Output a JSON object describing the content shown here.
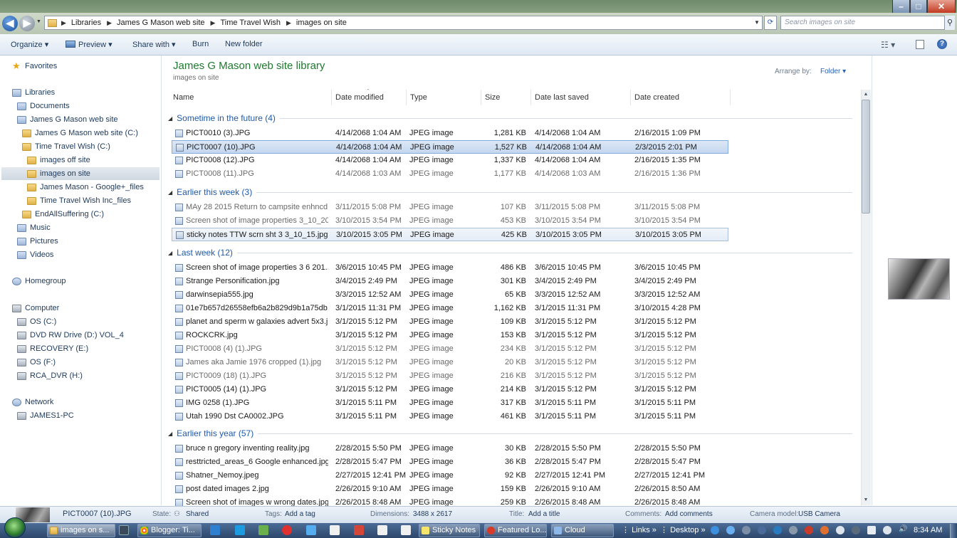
{
  "window": {
    "minimize": "–",
    "maximize": "□",
    "close": "✕"
  },
  "address": {
    "crumbs": [
      "Libraries",
      "James G Mason web site",
      "Time Travel Wish",
      "images on site"
    ],
    "search_placeholder": "Search images on site"
  },
  "toolbar": {
    "organize": "Organize ▾",
    "preview": "Preview ▾",
    "share_with": "Share with ▾",
    "burn": "Burn",
    "new_folder": "New folder"
  },
  "sidebar": {
    "favorites": "Favorites",
    "libraries": "Libraries",
    "documents": "Documents",
    "jgm_site": "James G Mason web site",
    "jgm_site_c": "James G Mason web site (C:)",
    "ttw_c": "Time Travel Wish (C:)",
    "images_off": "images off site",
    "images_on": "images on site",
    "jm_google": "James Mason - Google+_files",
    "ttw_inc": "Time Travel Wish Inc_files",
    "endall": "EndAllSuffering (C:)",
    "music": "Music",
    "pictures": "Pictures",
    "videos": "Videos",
    "homegroup": "Homegroup",
    "computer": "Computer",
    "os_c": "OS (C:)",
    "dvd": "DVD RW Drive (D:) VOL_4",
    "recovery": "RECOVERY (E:)",
    "os_f": "OS (F:)",
    "rca": "RCA_DVR (H:)",
    "network": "Network",
    "james1": "JAMES1-PC"
  },
  "library": {
    "title": "James G Mason web site library",
    "subtitle": "images on site",
    "arrange_label": "Arrange by:",
    "arrange_value": "Folder ▾"
  },
  "columns": {
    "name": "Name",
    "date_modified": "Date modified",
    "type": "Type",
    "size": "Size",
    "date_last_saved": "Date last saved",
    "date_created": "Date created"
  },
  "groups": [
    {
      "title": "Sometime in the future (4)",
      "rows": [
        {
          "name": "PICT0010 (3).JPG",
          "modified": "4/14/2068 1:04 AM",
          "type": "JPEG image",
          "size": "1,281 KB",
          "saved": "4/14/2068 1:04 AM",
          "created": "2/16/2015 1:09 PM"
        },
        {
          "name": "PICT0007 (10).JPG",
          "modified": "4/14/2068 1:04 AM",
          "type": "JPEG image",
          "size": "1,527 KB",
          "saved": "4/14/2068 1:04 AM",
          "created": "2/3/2015 2:01 PM"
        },
        {
          "name": "PICT0008 (12).JPG",
          "modified": "4/14/2068 1:04 AM",
          "type": "JPEG image",
          "size": "1,337 KB",
          "saved": "4/14/2068 1:04 AM",
          "created": "2/16/2015 1:35 PM"
        },
        {
          "name": "PICT0008 (11).JPG",
          "modified": "4/14/2068 1:03 AM",
          "type": "JPEG image",
          "size": "1,177 KB",
          "saved": "4/14/2068 1:03 AM",
          "created": "2/16/2015 1:36 PM"
        }
      ]
    },
    {
      "title": "Earlier this week (3)",
      "rows": [
        {
          "name": "MAy 28 2015 Return to campsite enhncd...",
          "modified": "3/11/2015 5:08 PM",
          "type": "JPEG image",
          "size": "107 KB",
          "saved": "3/11/2015 5:08 PM",
          "created": "3/11/2015 5:08 PM"
        },
        {
          "name": "Screen shot of image properties 3_10_20...",
          "modified": "3/10/2015 3:54 PM",
          "type": "JPEG image",
          "size": "453 KB",
          "saved": "3/10/2015 3:54 PM",
          "created": "3/10/2015 3:54 PM"
        },
        {
          "name": "sticky notes TTW scrn sht 3 3_10_15.jpg",
          "modified": "3/10/2015 3:05 PM",
          "type": "JPEG image",
          "size": "425 KB",
          "saved": "3/10/2015 3:05 PM",
          "created": "3/10/2015 3:05 PM"
        }
      ]
    },
    {
      "title": "Last week (12)",
      "rows": [
        {
          "name": "Screen shot of image properties 3 6 201...",
          "modified": "3/6/2015 10:45 PM",
          "type": "JPEG image",
          "size": "486 KB",
          "saved": "3/6/2015 10:45 PM",
          "created": "3/6/2015 10:45 PM"
        },
        {
          "name": "Strange Personification.jpg",
          "modified": "3/4/2015 2:49 PM",
          "type": "JPEG image",
          "size": "301 KB",
          "saved": "3/4/2015 2:49 PM",
          "created": "3/4/2015 2:49 PM"
        },
        {
          "name": "darwinsepia555.jpg",
          "modified": "3/3/2015 12:52 AM",
          "type": "JPEG image",
          "size": "65 KB",
          "saved": "3/3/2015 12:52 AM",
          "created": "3/3/2015 12:52 AM"
        },
        {
          "name": "01e7b657d26558efb6a2b829d9b1a75db...",
          "modified": "3/1/2015 11:31 PM",
          "type": "JPEG image",
          "size": "1,162 KB",
          "saved": "3/1/2015 11:31 PM",
          "created": "3/10/2015 4:28 PM"
        },
        {
          "name": "planet and sperm w galaxies advert 5x3.j...",
          "modified": "3/1/2015 5:12 PM",
          "type": "JPEG image",
          "size": "109 KB",
          "saved": "3/1/2015 5:12 PM",
          "created": "3/1/2015 5:12 PM"
        },
        {
          "name": "ROCKCRK.jpg",
          "modified": "3/1/2015 5:12 PM",
          "type": "JPEG image",
          "size": "153 KB",
          "saved": "3/1/2015 5:12 PM",
          "created": "3/1/2015 5:12 PM"
        },
        {
          "name": "PICT0008 (4) (1).JPG",
          "modified": "3/1/2015 5:12 PM",
          "type": "JPEG image",
          "size": "234 KB",
          "saved": "3/1/2015 5:12 PM",
          "created": "3/1/2015 5:12 PM"
        },
        {
          "name": "James aka Jamie 1976 cropped (1).jpg",
          "modified": "3/1/2015 5:12 PM",
          "type": "JPEG image",
          "size": "20 KB",
          "saved": "3/1/2015 5:12 PM",
          "created": "3/1/2015 5:12 PM"
        },
        {
          "name": "PICT0009 (18) (1).JPG",
          "modified": "3/1/2015 5:12 PM",
          "type": "JPEG image",
          "size": "216 KB",
          "saved": "3/1/2015 5:12 PM",
          "created": "3/1/2015 5:12 PM"
        },
        {
          "name": "PICT0005 (14) (1).JPG",
          "modified": "3/1/2015 5:12 PM",
          "type": "JPEG image",
          "size": "214 KB",
          "saved": "3/1/2015 5:12 PM",
          "created": "3/1/2015 5:12 PM"
        },
        {
          "name": "IMG 0258 (1).JPG",
          "modified": "3/1/2015 5:11 PM",
          "type": "JPEG image",
          "size": "317 KB",
          "saved": "3/1/2015 5:11 PM",
          "created": "3/1/2015 5:11 PM"
        },
        {
          "name": "Utah 1990 Dst CA0002.JPG",
          "modified": "3/1/2015 5:11 PM",
          "type": "JPEG image",
          "size": "461 KB",
          "saved": "3/1/2015 5:11 PM",
          "created": "3/1/2015 5:11 PM"
        }
      ]
    },
    {
      "title": "Earlier this year (57)",
      "rows": [
        {
          "name": "bruce n gregory inventing reality.jpg",
          "modified": "2/28/2015 5:50 PM",
          "type": "JPEG image",
          "size": "30 KB",
          "saved": "2/28/2015 5:50 PM",
          "created": "2/28/2015 5:50 PM"
        },
        {
          "name": "resttricted_areas_6 Google enhanced.jpg",
          "modified": "2/28/2015 5:47 PM",
          "type": "JPEG image",
          "size": "36 KB",
          "saved": "2/28/2015 5:47 PM",
          "created": "2/28/2015 5:47 PM"
        },
        {
          "name": "Shatner_Nemoy.jpeg",
          "modified": "2/27/2015 12:41 PM",
          "type": "JPEG image",
          "size": "92 KB",
          "saved": "2/27/2015 12:41 PM",
          "created": "2/27/2015 12:41 PM"
        },
        {
          "name": "post dated images 2.jpg",
          "modified": "2/26/2015 9:10 AM",
          "type": "JPEG image",
          "size": "159 KB",
          "saved": "2/26/2015 9:10 AM",
          "created": "2/26/2015 8:50 AM"
        },
        {
          "name": "Screen shot of images w wrong dates.jpg",
          "modified": "2/26/2015 8:48 AM",
          "type": "JPEG image",
          "size": "259 KB",
          "saved": "2/26/2015 8:48 AM",
          "created": "2/26/2015 8:48 AM"
        }
      ]
    }
  ],
  "details": {
    "filename": "PICT0007 (10).JPG",
    "state_label": "State:",
    "state_value": "Shared",
    "tags_label": "Tags:",
    "tags_value": "Add a tag",
    "dimensions_label": "Dimensions:",
    "dimensions_value": "3488 x 2617",
    "title_label": "Title:",
    "title_value": "Add a title",
    "comments_label": "Comments:",
    "comments_value": "Add comments",
    "camera_label": "Camera model:",
    "camera_value": "USB Camera"
  },
  "taskbar": {
    "explorer": "images on s...",
    "blogger": "Blogger: Ti...",
    "sticky": "Sticky Notes",
    "featured": "Featured Lo...",
    "cloud": "Cloud",
    "links": "Links",
    "desktop": "Desktop",
    "clock": "8:34 AM"
  }
}
